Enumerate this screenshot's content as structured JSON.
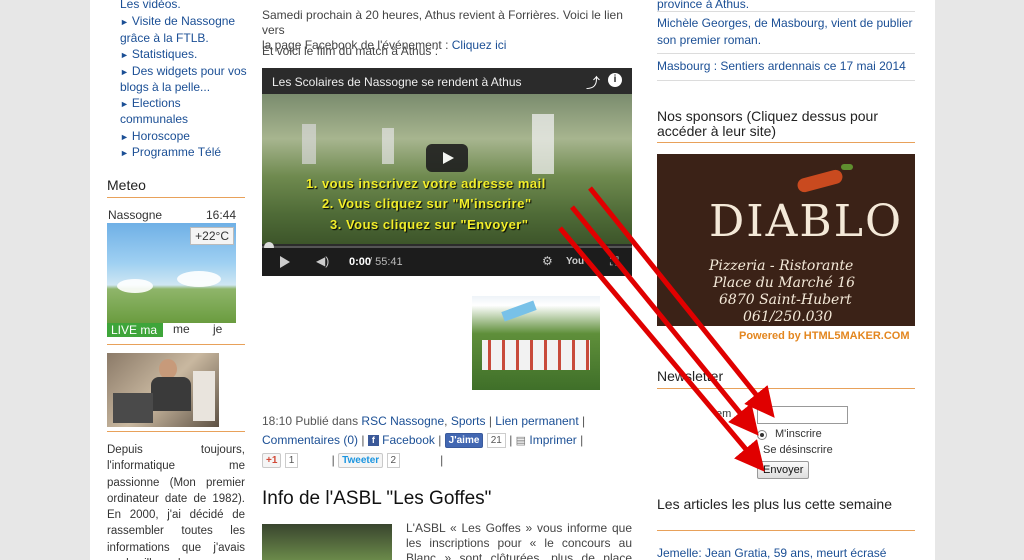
{
  "left_nav": [
    {
      "text": "Les vidéos.",
      "tri": false
    },
    {
      "text": "Visite de Nassogne",
      "tri": true
    },
    {
      "text": "grâce à la FTLB.",
      "tri": false
    },
    {
      "text": "Statistiques.",
      "tri": true
    },
    {
      "text": "Des widgets pour vos",
      "tri": true
    },
    {
      "text": "blogs à la pelle...",
      "tri": false
    },
    {
      "text": "Elections",
      "tri": true
    },
    {
      "text": "communales",
      "tri": false
    },
    {
      "text": "Horoscope",
      "tri": true
    },
    {
      "text": "Programme Télé",
      "tri": true
    }
  ],
  "meteo": {
    "title": "Meteo",
    "location": "Nassogne",
    "time": "16:44",
    "temperature": "+22°C",
    "tab_live": "LIVE ma",
    "tab_me": "me",
    "tab_je": "je"
  },
  "bio_text": "Depuis toujours, l'informatique me passionne (Mon premier ordinateur date de 1982). En 2000, j'ai décidé de rassembler toutes les informations que j'avais sur le village de",
  "main": {
    "intro_line1": "Samedi prochain à 20 heures, Athus revient à Forrières.  Voici le lien vers",
    "intro_line2a": "la page Facebook de l'événement : ",
    "intro_link": "Cliquez ici",
    "film_line": "Et voici le film du match à Athus :",
    "video": {
      "title": "Les Scolaires de Nassogne se rendent à Athus",
      "time_current": "0:00",
      "time_total": " / 55:41",
      "instructions": [
        "1. vous inscrivez votre adresse mail",
        "2. Vous cliquez sur \"M'inscrire\"",
        "3.  Vous cliquez sur \"Envoyer\""
      ]
    },
    "post_meta": {
      "time": "18:10 Publié dans ",
      "cat1": "RSC Nassogne",
      "cat2": "Sports",
      "permalink": "Lien permanent",
      "comments": "Commentaires (0)",
      "facebook": "Facebook",
      "jaime": "J'aime",
      "jaime_count": "21",
      "print": "Imprimer",
      "gplus": "+1",
      "gplus_count": "1",
      "tweet": "Tweeter",
      "tweet_count": "2"
    },
    "section_title": "Info de l'ASBL \"Les Goffes\"",
    "goffes_text": "L'ASBL « Les Goffes » vous informe que les inscriptions pour « le concours au Blanc » sont clôturées, plus de place disponible sauf"
  },
  "right": {
    "news": [
      "province à Athus.",
      "Michèle Georges, de Masbourg, vient de publier son premier roman.",
      "Masbourg : Sentiers ardennais ce 17 mai 2014"
    ],
    "sponsors_title": "Nos sponsors (Cliquez dessus pour accéder à leur site)",
    "sponsor": {
      "name": "DIABLO",
      "line1": "Pizzeria - Ristorante",
      "line2": "Place du Marché 16",
      "line3": "6870 Saint-Hubert",
      "line4": "061/250.030",
      "powered": "Powered by HTML5MAKER.COM"
    },
    "newsletter": {
      "title": "Newsletter",
      "email_label": "em",
      "subscribe": "M'inscrire",
      "unsubscribe": "Se désinscrire",
      "submit": "Envoyer"
    },
    "top_articles_title": "Les articles les plus lus cette semaine",
    "top_article_1": "Jemelle: Jean Gratia, 59 ans, meurt écrasé sous sa"
  },
  "colors": {
    "link": "#1b4f95",
    "orange_rule": "#e8a15a",
    "instruction_text": "#f2ee2a",
    "arrow": "#e00000",
    "live_badge": "#3ea53a"
  }
}
